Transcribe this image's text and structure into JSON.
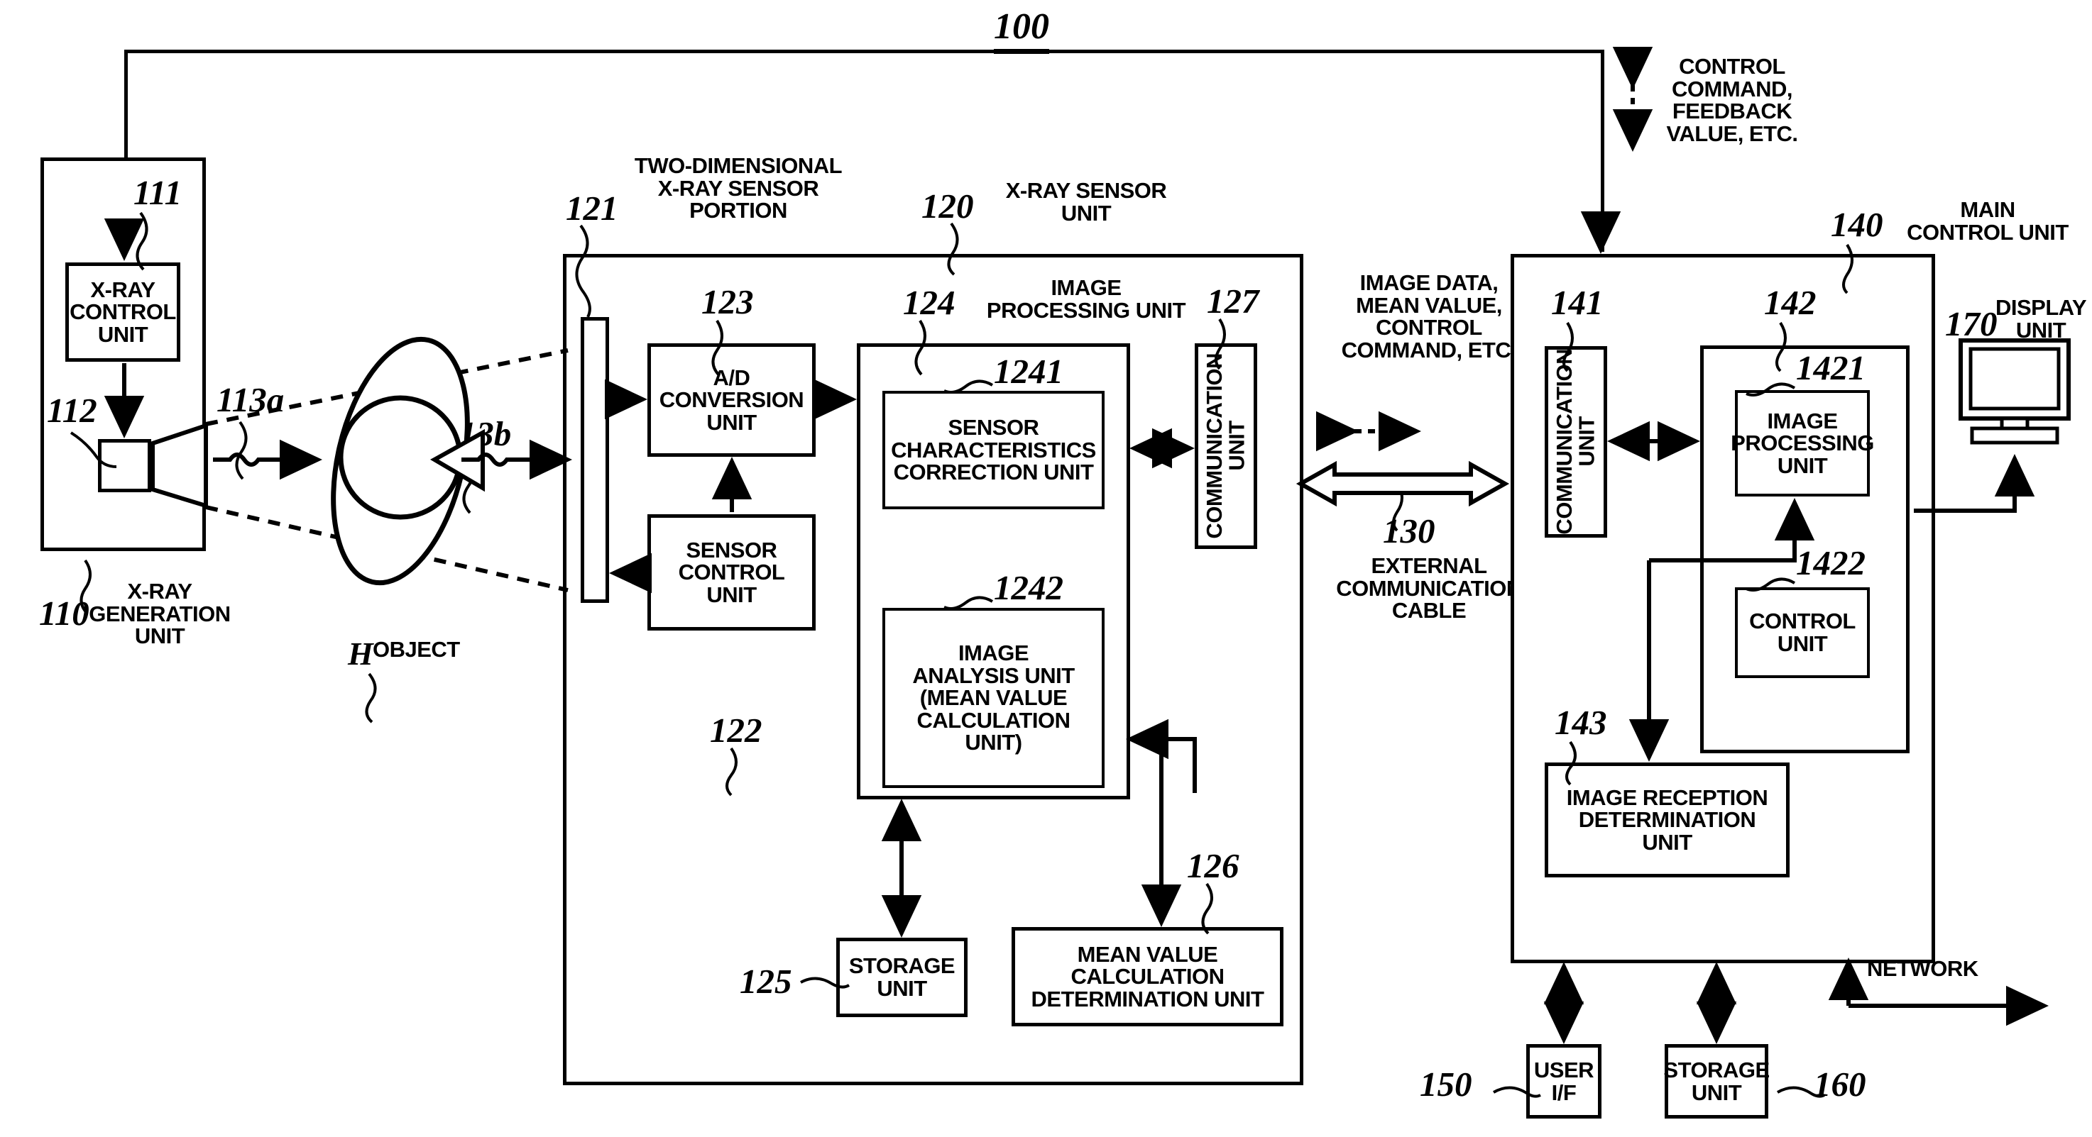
{
  "figure": {
    "number": "100"
  },
  "xray_generation": {
    "ref": "110",
    "caption": "X-RAY\nGENERATION\nUNIT",
    "control_unit": {
      "ref": "111",
      "label": "X-RAY\nCONTROL\nUNIT"
    },
    "tube": {
      "ref": "112"
    },
    "beam_a": {
      "ref": "113a"
    },
    "beam_b": {
      "ref": "113b"
    }
  },
  "object": {
    "ref": "H",
    "label": "OBJECT"
  },
  "sensor_unit": {
    "ref": "120",
    "caption": "X-RAY SENSOR\nUNIT",
    "sensor_portion": {
      "ref": "121",
      "caption": "TWO-DIMENSIONAL\nX-RAY SENSOR\nPORTION"
    },
    "sensor_control": {
      "ref": "122",
      "label": "SENSOR\nCONTROL\nUNIT"
    },
    "ad_conversion": {
      "ref": "123",
      "label": "A/D\nCONVERSION\nUNIT"
    },
    "image_processing": {
      "ref": "124",
      "caption": "IMAGE\nPROCESSING UNIT",
      "sensor_correction": {
        "ref": "1241",
        "label": "SENSOR\nCHARACTERISTICS\nCORRECTION UNIT"
      },
      "image_analysis": {
        "ref": "1242",
        "label": "IMAGE\nANALYSIS UNIT\n(MEAN VALUE\nCALCULATION\nUNIT)"
      }
    },
    "storage": {
      "ref": "125",
      "label": "STORAGE\nUNIT"
    },
    "mean_value_determination": {
      "ref": "126",
      "label": "MEAN VALUE\nCALCULATION\nDETERMINATION UNIT"
    },
    "communication": {
      "ref": "127",
      "label": "COMMUNICATION\nUNIT"
    }
  },
  "cable": {
    "ref": "130",
    "caption": "EXTERNAL\nCOMMUNICATION\nCABLE",
    "payload": "IMAGE DATA,\nMEAN VALUE,\nCONTROL\nCOMMAND, ETC."
  },
  "top_link": {
    "caption": "CONTROL\nCOMMAND,\nFEEDBACK\nVALUE, ETC."
  },
  "main_control": {
    "ref": "140",
    "caption": "MAIN\nCONTROL UNIT",
    "communication": {
      "ref": "141",
      "label": "COMMUNICATION\nUNIT"
    },
    "inner": {
      "ref": "142",
      "image_processing": {
        "ref": "1421",
        "label": "IMAGE\nPROCESSING\nUNIT"
      },
      "control_unit": {
        "ref": "1422",
        "label": "CONTROL\nUNIT"
      }
    },
    "image_reception": {
      "ref": "143",
      "label": "IMAGE RECEPTION\nDETERMINATION\nUNIT"
    }
  },
  "user_if": {
    "ref": "150",
    "label": "USER\nI/F"
  },
  "storage_unit": {
    "ref": "160",
    "label": "STORAGE\nUNIT"
  },
  "display_unit": {
    "ref": "170",
    "caption": "DISPLAY\nUNIT"
  },
  "network": {
    "label": "NETWORK"
  }
}
